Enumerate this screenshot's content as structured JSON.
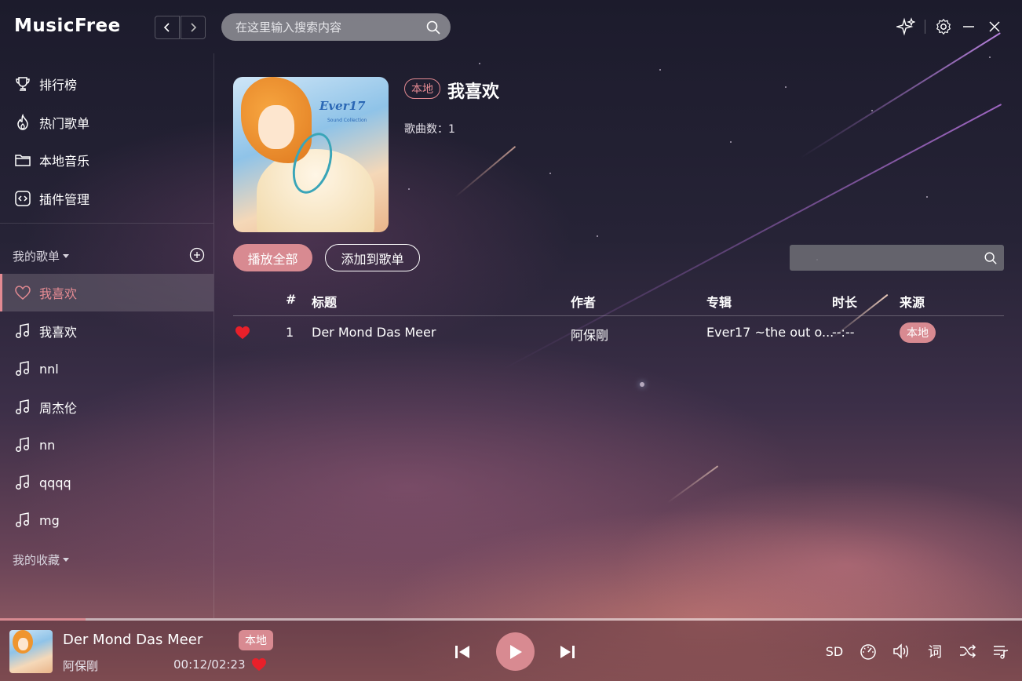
{
  "app": {
    "logo": "MusicFree",
    "search_placeholder": "在这里输入搜索内容"
  },
  "sidebar": {
    "nav": [
      {
        "label": "排行榜",
        "icon": "trophy-icon"
      },
      {
        "label": "热门歌单",
        "icon": "flame-icon"
      },
      {
        "label": "本地音乐",
        "icon": "folder-icon"
      },
      {
        "label": "插件管理",
        "icon": "plugin-icon"
      }
    ],
    "my_playlists_label": "我的歌单",
    "playlists": [
      {
        "label": "我喜欢",
        "icon": "heart-icon",
        "active": true
      },
      {
        "label": "我喜欢",
        "icon": "music-note-icon"
      },
      {
        "label": "nnl",
        "icon": "music-note-icon"
      },
      {
        "label": "周杰伦",
        "icon": "music-note-icon"
      },
      {
        "label": "nn",
        "icon": "music-note-icon"
      },
      {
        "label": "qqqq",
        "icon": "music-note-icon"
      },
      {
        "label": "mg",
        "icon": "music-note-icon"
      }
    ],
    "my_collections_label": "我的收藏"
  },
  "playlist": {
    "source_tag": "本地",
    "title": "我喜欢",
    "song_count_label": "歌曲数：1",
    "play_all": "播放全部",
    "add_to_playlist": "添加到歌单",
    "cover_title": "Ever17",
    "cover_subtitle": "Sound Collection",
    "filter_placeholder": ""
  },
  "table": {
    "headers": {
      "num": "#",
      "title": "标题",
      "artist": "作者",
      "album": "专辑",
      "duration": "时长",
      "source": "来源"
    },
    "rows": [
      {
        "liked": true,
        "num": "1",
        "title": "Der Mond Das Meer",
        "artist": "阿保剛",
        "album": "Ever17 ~the out o...",
        "duration": "--:--",
        "source": "本地"
      }
    ]
  },
  "player": {
    "song": "Der Mond Das Meer",
    "source_badge": "本地",
    "artist": "阿保剛",
    "time": "00:12/02:23",
    "progress": 0.084,
    "quality": "SD",
    "lyrics": "词",
    "liked": true
  },
  "colors": {
    "accent": "#d88a91",
    "accent_text": "#e38a92",
    "heart": "#e8202a"
  }
}
